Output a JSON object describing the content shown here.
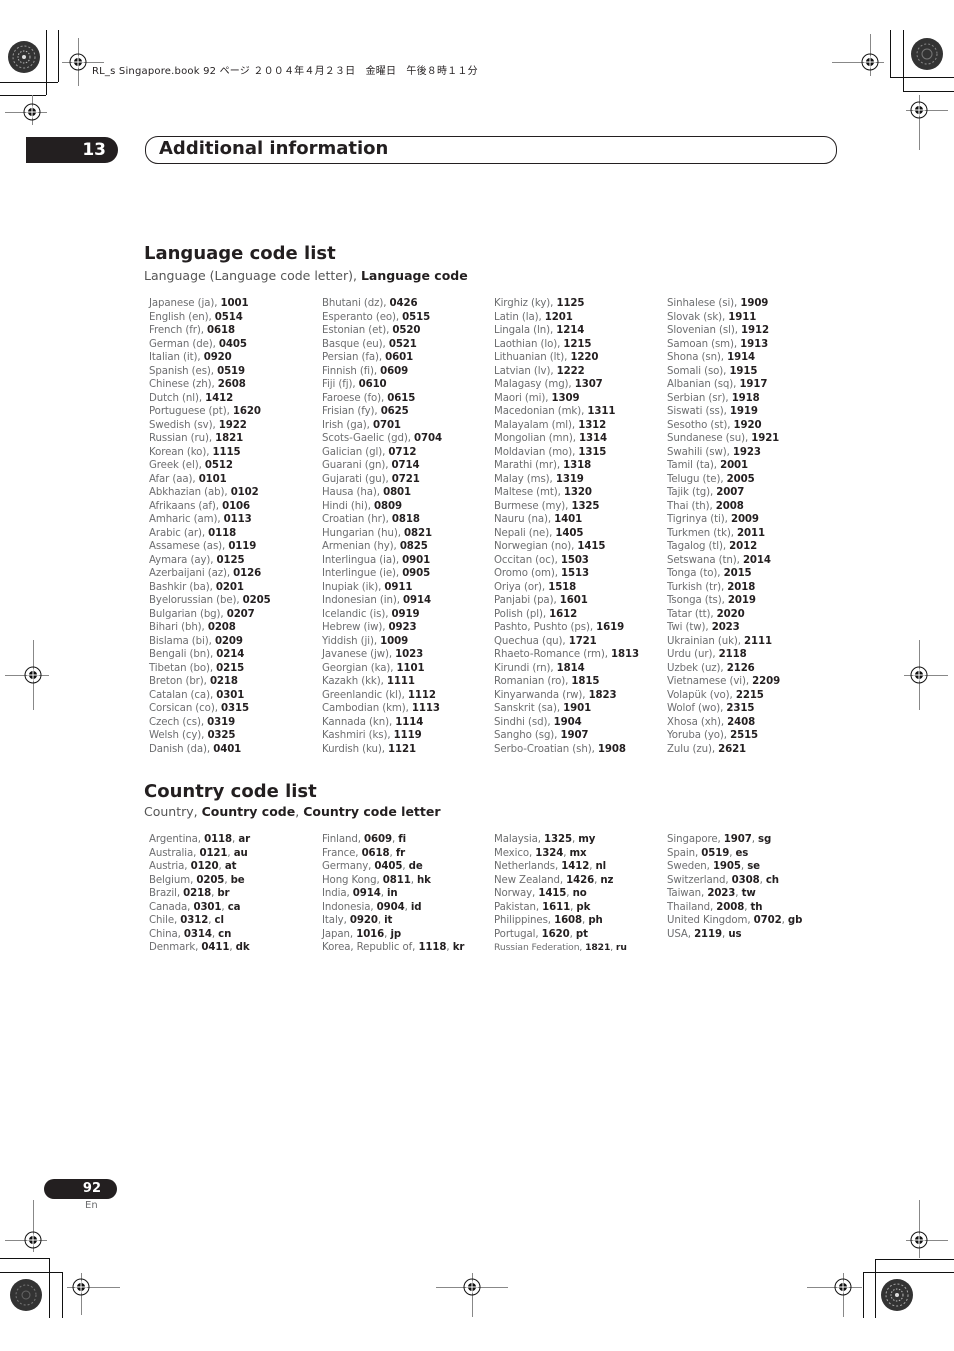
{
  "file_header": "RL_s Singapore.book  92 ページ  ２００４年４月２３日　金曜日　午後８時１１分",
  "chapter": {
    "number": "13",
    "title": "Additional information"
  },
  "language_section": {
    "title": "Language code list",
    "subtitle_plain": "Language (Language code letter), ",
    "subtitle_bold": "Language code",
    "columns": [
      [
        {
          "name": "Japanese (ja), ",
          "code": "1001"
        },
        {
          "name": "English (en), ",
          "code": "0514"
        },
        {
          "name": "French (fr), ",
          "code": "0618"
        },
        {
          "name": "German (de), ",
          "code": "0405"
        },
        {
          "name": "Italian (it), ",
          "code": "0920"
        },
        {
          "name": "Spanish (es), ",
          "code": "0519"
        },
        {
          "name": "Chinese (zh), ",
          "code": "2608"
        },
        {
          "name": "Dutch (nl), ",
          "code": "1412"
        },
        {
          "name": "Portuguese (pt), ",
          "code": "1620"
        },
        {
          "name": "Swedish (sv), ",
          "code": "1922"
        },
        {
          "name": "Russian (ru), ",
          "code": "1821"
        },
        {
          "name": "Korean (ko), ",
          "code": "1115"
        },
        {
          "name": "Greek (el), ",
          "code": "0512"
        },
        {
          "name": "Afar (aa), ",
          "code": "0101"
        },
        {
          "name": "Abkhazian (ab), ",
          "code": "0102"
        },
        {
          "name": "Afrikaans (af), ",
          "code": "0106"
        },
        {
          "name": "Amharic (am), ",
          "code": "0113"
        },
        {
          "name": "Arabic (ar), ",
          "code": "0118"
        },
        {
          "name": "Assamese (as), ",
          "code": "0119"
        },
        {
          "name": "Aymara (ay), ",
          "code": "0125"
        },
        {
          "name": "Azerbaijani (az), ",
          "code": "0126"
        },
        {
          "name": "Bashkir (ba), ",
          "code": "0201"
        },
        {
          "name": "Byelorussian (be), ",
          "code": "0205"
        },
        {
          "name": "Bulgarian (bg), ",
          "code": "0207"
        },
        {
          "name": "Bihari (bh), ",
          "code": "0208"
        },
        {
          "name": "Bislama (bi), ",
          "code": "0209"
        },
        {
          "name": "Bengali (bn), ",
          "code": "0214"
        },
        {
          "name": "Tibetan (bo), ",
          "code": "0215"
        },
        {
          "name": "Breton (br), ",
          "code": "0218"
        },
        {
          "name": "Catalan (ca), ",
          "code": "0301"
        },
        {
          "name": "Corsican (co), ",
          "code": "0315"
        },
        {
          "name": "Czech (cs), ",
          "code": "0319"
        },
        {
          "name": "Welsh (cy), ",
          "code": "0325"
        },
        {
          "name": "Danish (da), ",
          "code": "0401"
        }
      ],
      [
        {
          "name": "Bhutani (dz), ",
          "code": "0426"
        },
        {
          "name": "Esperanto (eo), ",
          "code": "0515"
        },
        {
          "name": "Estonian (et), ",
          "code": "0520"
        },
        {
          "name": "Basque (eu), ",
          "code": "0521"
        },
        {
          "name": "Persian (fa), ",
          "code": "0601"
        },
        {
          "name": "Finnish (fi), ",
          "code": "0609"
        },
        {
          "name": "Fiji (fj), ",
          "code": "0610"
        },
        {
          "name": "Faroese (fo), ",
          "code": "0615"
        },
        {
          "name": "Frisian (fy), ",
          "code": "0625"
        },
        {
          "name": "Irish (ga), ",
          "code": "0701"
        },
        {
          "name": "Scots-Gaelic (gd), ",
          "code": "0704"
        },
        {
          "name": "Galician (gl), ",
          "code": "0712"
        },
        {
          "name": "Guarani (gn), ",
          "code": "0714"
        },
        {
          "name": "Gujarati (gu), ",
          "code": "0721"
        },
        {
          "name": "Hausa (ha), ",
          "code": "0801"
        },
        {
          "name": "Hindi (hi), ",
          "code": "0809"
        },
        {
          "name": "Croatian (hr), ",
          "code": "0818"
        },
        {
          "name": "Hungarian (hu), ",
          "code": "0821"
        },
        {
          "name": "Armenian (hy), ",
          "code": "0825"
        },
        {
          "name": "Interlingua (ia), ",
          "code": "0901"
        },
        {
          "name": "Interlingue (ie), ",
          "code": "0905"
        },
        {
          "name": "Inupiak (ik), ",
          "code": "0911"
        },
        {
          "name": "Indonesian (in), ",
          "code": "0914"
        },
        {
          "name": "Icelandic (is), ",
          "code": "0919"
        },
        {
          "name": "Hebrew (iw), ",
          "code": "0923"
        },
        {
          "name": "Yiddish (ji), ",
          "code": "1009"
        },
        {
          "name": "Javanese (jw), ",
          "code": "1023"
        },
        {
          "name": "Georgian (ka), ",
          "code": "1101"
        },
        {
          "name": "Kazakh (kk), ",
          "code": "1111"
        },
        {
          "name": "Greenlandic  (kl), ",
          "code": "1112"
        },
        {
          "name": "Cambodian (km), ",
          "code": "1113"
        },
        {
          "name": "Kannada (kn), ",
          "code": "1114"
        },
        {
          "name": "Kashmiri (ks), ",
          "code": "1119"
        },
        {
          "name": "Kurdish (ku), ",
          "code": "1121"
        }
      ],
      [
        {
          "name": "Kirghiz (ky), ",
          "code": "1125"
        },
        {
          "name": "Latin (la), ",
          "code": "1201"
        },
        {
          "name": "Lingala (ln), ",
          "code": "1214"
        },
        {
          "name": "Laothian (lo), ",
          "code": "1215"
        },
        {
          "name": "Lithuanian (lt), ",
          "code": "1220"
        },
        {
          "name": "Latvian (lv), ",
          "code": "1222"
        },
        {
          "name": "Malagasy (mg), ",
          "code": "1307"
        },
        {
          "name": "Maori (mi), ",
          "code": "1309"
        },
        {
          "name": "Macedonian (mk), ",
          "code": "1311"
        },
        {
          "name": "Malayalam  (ml), ",
          "code": "1312"
        },
        {
          "name": "Mongolian (mn), ",
          "code": "1314"
        },
        {
          "name": "Moldavian (mo), ",
          "code": "1315"
        },
        {
          "name": "Marathi (mr), ",
          "code": "1318"
        },
        {
          "name": "Malay  (ms), ",
          "code": "1319"
        },
        {
          "name": "Maltese (mt), ",
          "code": "1320"
        },
        {
          "name": "Burmese (my), ",
          "code": "1325"
        },
        {
          "name": "Nauru (na), ",
          "code": "1401"
        },
        {
          "name": "Nepali (ne), ",
          "code": "1405"
        },
        {
          "name": "Norwegian (no), ",
          "code": "1415"
        },
        {
          "name": "Occitan (oc), ",
          "code": "1503"
        },
        {
          "name": "Oromo (om), ",
          "code": "1513"
        },
        {
          "name": "Oriya (or), ",
          "code": "1518"
        },
        {
          "name": "Panjabi (pa), ",
          "code": "1601"
        },
        {
          "name": "Polish (pl), ",
          "code": "1612"
        },
        {
          "name": "Pashto, Pushto (ps), ",
          "code": "1619"
        },
        {
          "name": "Quechua (qu), ",
          "code": "1721"
        },
        {
          "name": "Rhaeto-Romance (rm), ",
          "code": "1813"
        },
        {
          "name": "Kirundi (rn), ",
          "code": "1814"
        },
        {
          "name": "Romanian (ro), ",
          "code": "1815"
        },
        {
          "name": "Kinyarwanda (rw), ",
          "code": "1823"
        },
        {
          "name": "Sanskrit (sa), ",
          "code": "1901"
        },
        {
          "name": "Sindhi (sd), ",
          "code": "1904"
        },
        {
          "name": "Sangho (sg), ",
          "code": "1907"
        },
        {
          "name": "Serbo-Croatian (sh), ",
          "code": "1908"
        }
      ],
      [
        {
          "name": "Sinhalese (si), ",
          "code": "1909"
        },
        {
          "name": "Slovak (sk), ",
          "code": "1911"
        },
        {
          "name": "Slovenian (sl), ",
          "code": "1912"
        },
        {
          "name": "Samoan (sm), ",
          "code": "1913"
        },
        {
          "name": "Shona (sn), ",
          "code": "1914"
        },
        {
          "name": "Somali (so), ",
          "code": "1915"
        },
        {
          "name": "Albanian (sq), ",
          "code": "1917"
        },
        {
          "name": "Serbian (sr), ",
          "code": "1918"
        },
        {
          "name": "Siswati (ss), ",
          "code": "1919"
        },
        {
          "name": "Sesotho (st), ",
          "code": "1920"
        },
        {
          "name": "Sundanese (su), ",
          "code": "1921"
        },
        {
          "name": "Swahili (sw), ",
          "code": "1923"
        },
        {
          "name": "Tamil (ta), ",
          "code": "2001"
        },
        {
          "name": "Telugu (te), ",
          "code": "2005"
        },
        {
          "name": "Tajik (tg), ",
          "code": "2007"
        },
        {
          "name": "Thai (th), ",
          "code": "2008"
        },
        {
          "name": "Tigrinya (ti), ",
          "code": "2009"
        },
        {
          "name": "Turkmen (tk), ",
          "code": "2011"
        },
        {
          "name": "Tagalog (tl), ",
          "code": "2012"
        },
        {
          "name": "Setswana (tn), ",
          "code": "2014"
        },
        {
          "name": "Tonga (to), ",
          "code": "2015"
        },
        {
          "name": "Turkish (tr), ",
          "code": "2018"
        },
        {
          "name": "Tsonga (ts), ",
          "code": "2019"
        },
        {
          "name": "Tatar (tt), ",
          "code": "2020"
        },
        {
          "name": "Twi (tw), ",
          "code": "2023"
        },
        {
          "name": "Ukrainian (uk), ",
          "code": "2111"
        },
        {
          "name": "Urdu (ur), ",
          "code": "2118"
        },
        {
          "name": "Uzbek (uz), ",
          "code": "2126"
        },
        {
          "name": "Vietnamese (vi), ",
          "code": "2209"
        },
        {
          "name": "Volapük (vo), ",
          "code": "2215"
        },
        {
          "name": "Wolof (wo), ",
          "code": "2315"
        },
        {
          "name": "Xhosa (xh), ",
          "code": "2408"
        },
        {
          "name": "Yoruba (yo), ",
          "code": "2515"
        },
        {
          "name": "Zulu (zu), ",
          "code": "2621"
        }
      ]
    ]
  },
  "country_section": {
    "title": "Country code list",
    "subtitle_plain": "Country, ",
    "subtitle_bold1": "Country code",
    "subtitle_sep": ", ",
    "subtitle_bold2": "Country code letter",
    "columns": [
      [
        {
          "name": "Argentina, ",
          "code": "0118",
          "letter": "ar"
        },
        {
          "name": "Australia, ",
          "code": "0121",
          "letter": "au"
        },
        {
          "name": "Austria, ",
          "code": "0120",
          "letter": "at"
        },
        {
          "name": "Belgium, ",
          "code": "0205",
          "letter": "be"
        },
        {
          "name": "Brazil, ",
          "code": "0218",
          "letter": "br"
        },
        {
          "name": "Canada, ",
          "code": "0301",
          "letter": "ca"
        },
        {
          "name": "Chile, ",
          "code": "0312",
          "letter": "cl"
        },
        {
          "name": "China, ",
          "code": "0314",
          "letter": "cn"
        },
        {
          "name": "Denmark, ",
          "code": "0411",
          "letter": "dk"
        }
      ],
      [
        {
          "name": "Finland, ",
          "code": "0609",
          "letter": "fi"
        },
        {
          "name": "France, ",
          "code": "0618",
          "letter": "fr"
        },
        {
          "name": "Germany, ",
          "code": "0405",
          "letter": "de"
        },
        {
          "name": "Hong Kong, ",
          "code": "0811",
          "letter": "hk"
        },
        {
          "name": "India, ",
          "code": "0914",
          "letter": "in"
        },
        {
          "name": "Indonesia, ",
          "code": "0904",
          "letter": "id"
        },
        {
          "name": "Italy, ",
          "code": "0920",
          "letter": "it"
        },
        {
          "name": "Japan, ",
          "code": "1016",
          "letter": "jp"
        },
        {
          "name": "Korea, Republic of, ",
          "code": "1118",
          "letter": "kr"
        }
      ],
      [
        {
          "name": "Malaysia, ",
          "code": "1325",
          "letter": "my"
        },
        {
          "name": "Mexico, ",
          "code": "1324",
          "letter": "mx"
        },
        {
          "name": "Netherlands, ",
          "code": "1412",
          "letter": "nl"
        },
        {
          "name": "New Zealand, ",
          "code": "1426",
          "letter": "nz"
        },
        {
          "name": "Norway, ",
          "code": "1415",
          "letter": "no"
        },
        {
          "name": "Pakistan, ",
          "code": "1611",
          "letter": "pk"
        },
        {
          "name": "Philippines, ",
          "code": "1608",
          "letter": "ph"
        },
        {
          "name": "Portugal, ",
          "code": "1620",
          "letter": "pt"
        },
        {
          "name": "Russian Federation, ",
          "code": "1821",
          "letter": "ru",
          "small": true
        }
      ],
      [
        {
          "name": "Singapore, ",
          "code": "1907",
          "letter": "sg"
        },
        {
          "name": "Spain, ",
          "code": "0519",
          "letter": "es"
        },
        {
          "name": "Sweden, ",
          "code": "1905",
          "letter": "se"
        },
        {
          "name": "Switzerland, ",
          "code": "0308",
          "letter": "ch"
        },
        {
          "name": "Taiwan, ",
          "code": "2023",
          "letter": "tw"
        },
        {
          "name": "Thailand, ",
          "code": "2008",
          "letter": "th"
        },
        {
          "name": "United Kingdom, ",
          "code": "0702",
          "letter": "gb"
        },
        {
          "name": "USA, ",
          "code": "2119",
          "letter": "us"
        }
      ]
    ]
  },
  "footer": {
    "page_number": "92",
    "language": "En"
  },
  "colors": {
    "ink": "#231f20",
    "gray_text": "#6d6e70",
    "mark_gray": "#888888"
  }
}
